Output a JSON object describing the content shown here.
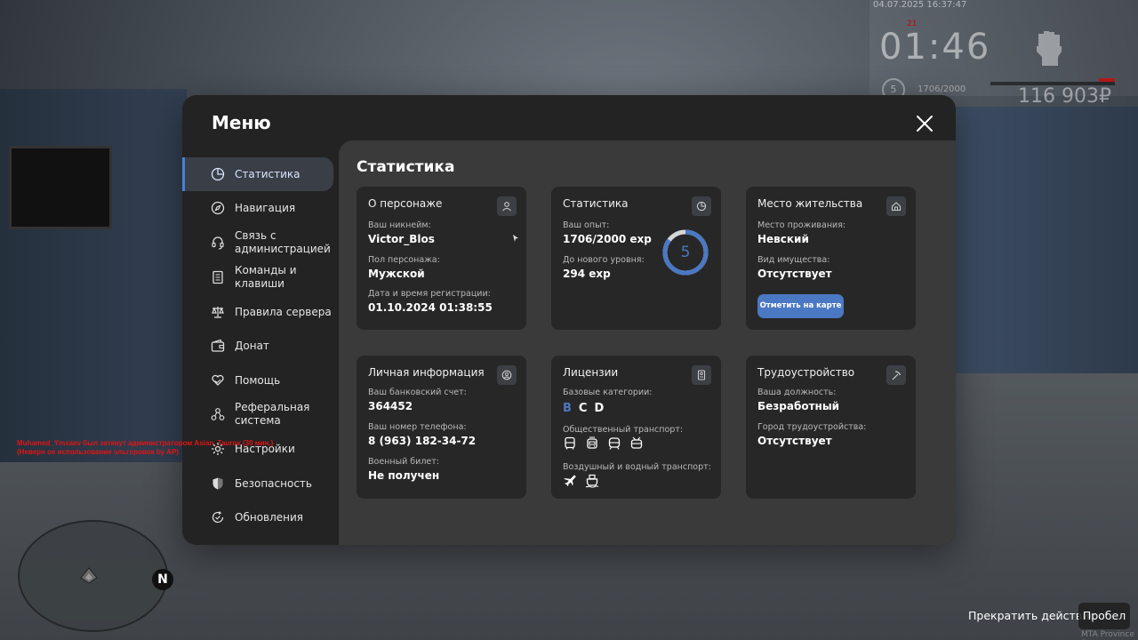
{
  "hud": {
    "datetime": "04.07.2025 16:37:47",
    "time": "01:46",
    "mark": "21",
    "level": "5",
    "exp": "1706/2000",
    "money": "116 903₽",
    "icon": "fist-icon"
  },
  "chat": {
    "message": "Muhamed_Ymxaev был заткнут администратором Asian_Taurov (30 мин.) (Неверн ое использование эльгоровок by AP)"
  },
  "radar": {
    "north": "N"
  },
  "prompt": {
    "action": "Прекратить действие",
    "key": "Пробел"
  },
  "watermark": "MTA Province 9",
  "menu": {
    "title": "Меню",
    "sidebar": [
      {
        "label": "Статистика",
        "icon": "pie-chart-icon",
        "active": true
      },
      {
        "label": "Навигация",
        "icon": "compass-icon"
      },
      {
        "label": "Связь с администрацией",
        "icon": "headset-icon"
      },
      {
        "label": "Команды и клавиши",
        "icon": "document-icon"
      },
      {
        "label": "Правила сервера",
        "icon": "scales-icon"
      },
      {
        "label": "Донат",
        "icon": "wallet-icon"
      },
      {
        "label": "Помощь",
        "icon": "heart-hand-icon"
      },
      {
        "label": "Реферальная система",
        "icon": "network-icon"
      },
      {
        "label": "Настройки",
        "icon": "gear-icon"
      },
      {
        "label": "Безопасность",
        "icon": "shield-icon"
      },
      {
        "label": "Обновления",
        "icon": "refresh-check-icon"
      }
    ],
    "content": {
      "title": "Статистика",
      "character": {
        "title": "О персонаже",
        "nickname_label": "Ваш никнейм:",
        "nickname": "Victor_Blos",
        "gender_label": "Пол персонажа:",
        "gender": "Мужской",
        "reg_label": "Дата и время регистрации:",
        "reg": "01.10.2024 01:38:55"
      },
      "stats": {
        "title": "Статистика",
        "exp_label": "Ваш опыт:",
        "exp": "1706/2000 exp",
        "next_label": "До нового уровня:",
        "next": "294 exp",
        "level": "5",
        "progress": 0.853,
        "accent": "#4b78c2"
      },
      "residence": {
        "title": "Место жительства",
        "place_label": "Место проживания:",
        "place": "Невский",
        "property_label": "Вид имущества:",
        "property": "Отсутствует",
        "button": "Отметить на карте"
      },
      "personal": {
        "title": "Личная информация",
        "bank_label": "Ваш банковский счет:",
        "bank": "364452",
        "phone_label": "Ваш номер телефона:",
        "phone": "8 (963) 182-34-72",
        "military_label": "Военный билет:",
        "military": "Не получен"
      },
      "licenses": {
        "title": "Лицензии",
        "base_label": "Базовые категории:",
        "categories": [
          {
            "name": "B",
            "color": "#4b78c2"
          },
          {
            "name": "C",
            "color": "#ffffff"
          },
          {
            "name": "D",
            "color": "#ffffff"
          }
        ],
        "public_label": "Общественный транспорт:",
        "public_icons": [
          "bus-icon",
          "tram-icon",
          "train-icon",
          "trolleybus-icon"
        ],
        "air_label": "Воздушный и водный транспорт:",
        "air_icons": [
          "plane-icon",
          "ship-icon"
        ]
      },
      "employment": {
        "title": "Трудоустройство",
        "position_label": "Ваша должность:",
        "position": "Безработный",
        "city_label": "Город трудоустройства:",
        "city": "Отсутствует"
      }
    }
  }
}
